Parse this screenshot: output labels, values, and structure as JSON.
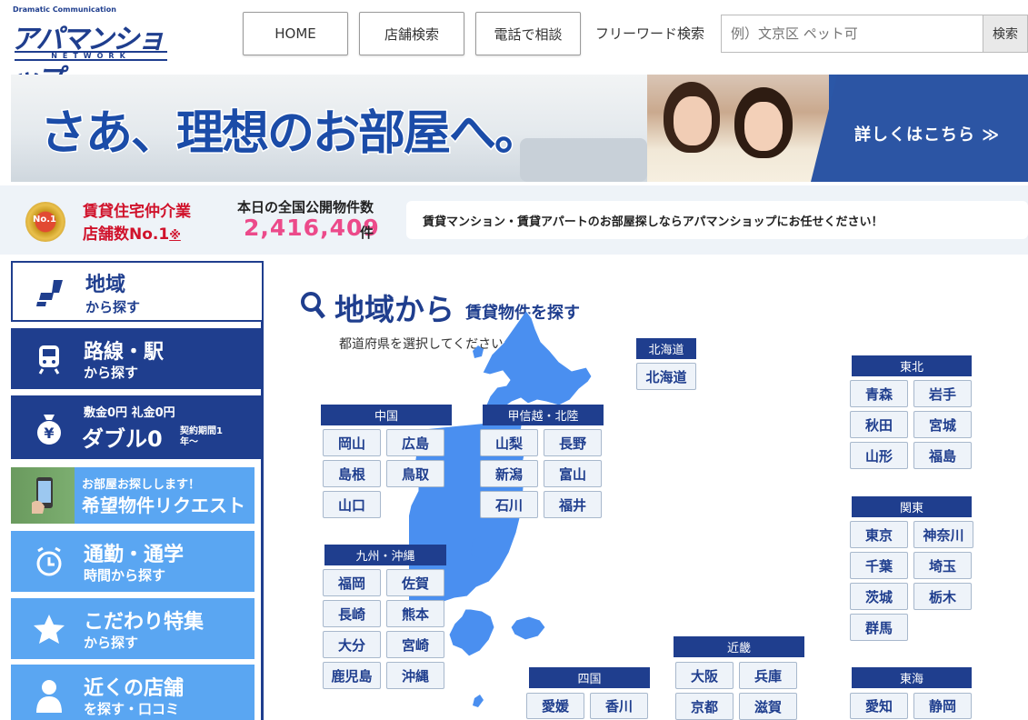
{
  "header": {
    "logo_tagline": "Dramatic Communication",
    "logo_name": "アパマンショップ",
    "logo_network": "NETWORK",
    "nav": [
      "HOME",
      "店舗検索",
      "電話で相談"
    ],
    "freeword_label": "フリーワード検索",
    "search_placeholder": "例）文京区 ペット可",
    "search_button": "検索"
  },
  "banner": {
    "headline": "さあ、理想のお部屋へ。",
    "more_link": "詳しくはこちら ≫"
  },
  "info": {
    "medal_text": "No.1",
    "rank_line1": "賃貸住宅仲介業",
    "rank_line2": "店舗数No.1",
    "rank_note": "※",
    "today_label": "本日の全国公開物件数",
    "count": "2,416,409",
    "count_unit": "件",
    "message": "賃貸マンション・賃貸アパートのお部屋探しならアパマンショップにお任せください！"
  },
  "sidebar": [
    {
      "icon": "map-pin-icon",
      "line1": "地域",
      "line2": "から探す",
      "state": "active"
    },
    {
      "icon": "train-icon",
      "line1": "路線・駅",
      "line2": "から探す",
      "state": "dark"
    },
    {
      "icon": "money-bag-icon",
      "line0": "敷金0円 礼金0円",
      "line1": "ダブル0",
      "line2": "契約期間1年〜",
      "state": "dark"
    },
    {
      "icon": "smartphone-icon",
      "line0": "お部屋お探しします！",
      "line1": "希望物件リクエスト",
      "state": "light"
    },
    {
      "icon": "alarm-clock-icon",
      "line1": "通勤・通学",
      "line2": "時間から探す",
      "state": "light"
    },
    {
      "icon": "star-icon",
      "line1": "こだわり特集",
      "line2": "から探す",
      "state": "light"
    },
    {
      "icon": "person-icon",
      "line1": "近くの店舗",
      "line2": "を探す・口コミ",
      "state": "light"
    }
  ],
  "main": {
    "title": "地域から",
    "subtitle": "賃貸物件を探す",
    "hint": "都道府県を選択してください。"
  },
  "regions": {
    "hokkaido": {
      "name": "北海道",
      "prefs": [
        "北海道"
      ]
    },
    "tohoku": {
      "name": "東北",
      "prefs": [
        "青森",
        "岩手",
        "秋田",
        "宮城",
        "山形",
        "福島"
      ]
    },
    "chugoku": {
      "name": "中国",
      "prefs": [
        "岡山",
        "広島",
        "島根",
        "鳥取",
        "山口"
      ]
    },
    "koshinetsu": {
      "name": "甲信越・北陸",
      "prefs": [
        "山梨",
        "長野",
        "新潟",
        "富山",
        "石川",
        "福井"
      ]
    },
    "kanto": {
      "name": "関東",
      "prefs": [
        "東京",
        "神奈川",
        "千葉",
        "埼玉",
        "茨城",
        "栃木",
        "群馬"
      ]
    },
    "kyushu": {
      "name": "九州・沖縄",
      "prefs": [
        "福岡",
        "佐賀",
        "長崎",
        "熊本",
        "大分",
        "宮崎",
        "鹿児島",
        "沖縄"
      ]
    },
    "shikoku": {
      "name": "四国",
      "prefs": [
        "愛媛",
        "香川"
      ]
    },
    "kinki": {
      "name": "近畿",
      "prefs": [
        "大阪",
        "兵庫",
        "京都",
        "滋賀"
      ]
    },
    "tokai": {
      "name": "東海",
      "prefs": [
        "愛知",
        "静岡"
      ]
    }
  },
  "colors": {
    "brand_navy": "#1f3e8e",
    "light_blue": "#5aa6f2",
    "count_pink": "#ec4a8a",
    "rank_red": "#d0122b"
  }
}
